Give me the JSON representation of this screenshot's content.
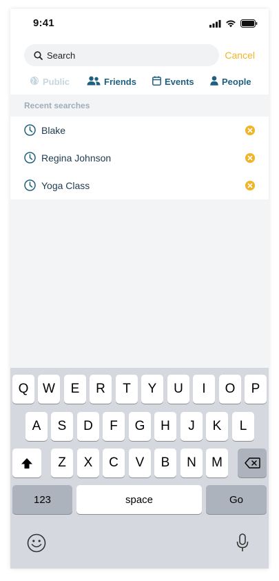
{
  "status": {
    "time": "9:41"
  },
  "search": {
    "placeholder": "Search",
    "cancel_label": "Cancel"
  },
  "filters": [
    {
      "label": "Public",
      "icon": "globe-icon",
      "enabled": false
    },
    {
      "label": "Friends",
      "icon": "friends-icon",
      "enabled": true
    },
    {
      "label": "Events",
      "icon": "calendar-icon",
      "enabled": true
    },
    {
      "label": "People",
      "icon": "person-icon",
      "enabled": true
    }
  ],
  "recent": {
    "header": "Recent searches",
    "items": [
      {
        "label": "Blake"
      },
      {
        "label": "Regina Johnson"
      },
      {
        "label": "Yoga Class"
      }
    ]
  },
  "keyboard": {
    "row1": [
      "Q",
      "W",
      "E",
      "R",
      "T",
      "Y",
      "U",
      "I",
      "O",
      "P"
    ],
    "row2": [
      "A",
      "S",
      "D",
      "F",
      "G",
      "H",
      "J",
      "K",
      "L"
    ],
    "row3": [
      "Z",
      "X",
      "C",
      "V",
      "B",
      "N",
      "M"
    ],
    "numbers_label": "123",
    "space_label": "space",
    "go_label": "Go"
  },
  "colors": {
    "accent": "#f0b429",
    "primary": "#1f5f7f",
    "disabled": "#c8d6e0"
  }
}
